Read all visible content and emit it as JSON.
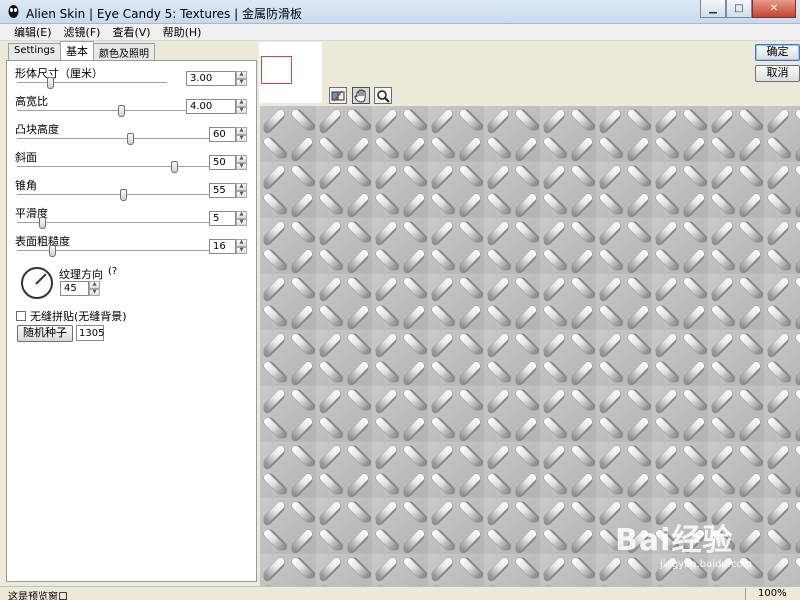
{
  "window": {
    "title": "Alien Skin | Eye Candy 5: Textures | 金属防滑板"
  },
  "menu": {
    "items": [
      "编辑(E)",
      "滤镜(F)",
      "查看(V)",
      "帮助(H)"
    ]
  },
  "tabs": {
    "settings": "Settings",
    "basic": "基本",
    "lighting": "颜色及照明"
  },
  "params": [
    {
      "label": "形体尺寸（厘米）",
      "value": "3.00",
      "level": 0.22
    },
    {
      "label": "高宽比",
      "value": "4.00",
      "level": 0.61
    },
    {
      "label": "凸块高度",
      "value": "60",
      "level": 0.59
    },
    {
      "label": "斜面",
      "value": "50",
      "level": 0.82
    },
    {
      "label": "锥角",
      "value": "55",
      "level": 0.55
    },
    {
      "label": "平滑度",
      "value": "5",
      "level": 0.13
    },
    {
      "label": "表面粗糙度",
      "value": "16",
      "level": 0.18
    }
  ],
  "direction": {
    "label": "纹理方向",
    "help": "(?",
    "value": "45"
  },
  "seamless": {
    "label": "无缝拼贴(无缝背景)",
    "checked": false
  },
  "seed": {
    "button": "随机种子",
    "value": "1305"
  },
  "actions": {
    "ok": "确定",
    "cancel": "取消"
  },
  "tools": [
    "compare-icon",
    "hand-icon",
    "zoom-icon"
  ],
  "watermark": {
    "brand": "Bai经验",
    "url": "jingyan.baidu.com"
  },
  "status": {
    "message": "这是预览窗口",
    "zoom": "100%"
  }
}
